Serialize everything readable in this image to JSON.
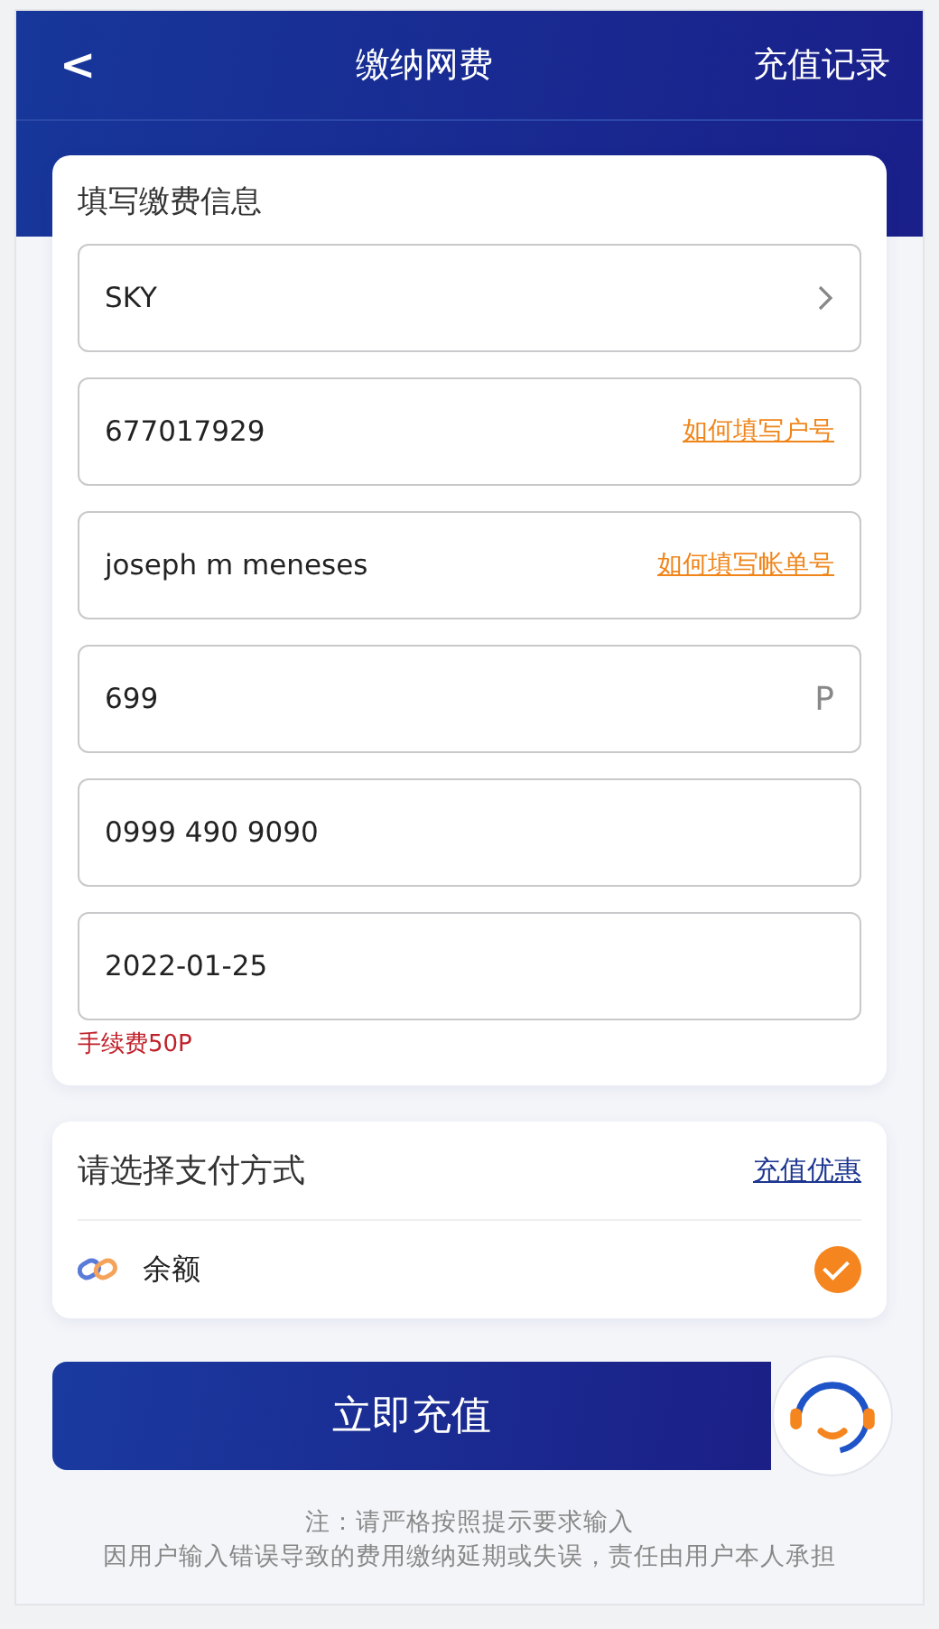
{
  "header": {
    "back": "<",
    "title": "缴纳网费",
    "action": "充值记录"
  },
  "form": {
    "title": "填写缴费信息",
    "fields": [
      {
        "kind": "select",
        "value": "SKY"
      },
      {
        "kind": "link",
        "value": "677017929",
        "link": "如何填写户号"
      },
      {
        "kind": "link",
        "value": "joseph m meneses",
        "link": "如何填写帐单号"
      },
      {
        "kind": "unit",
        "value": "699",
        "unit": "P"
      },
      {
        "kind": "plain",
        "value": "0999 490 9090"
      },
      {
        "kind": "plain",
        "value": "2022-01-25"
      }
    ],
    "fee": "手续费50P"
  },
  "payment": {
    "title": "请选择支付方式",
    "link": "充值优惠",
    "methods": [
      {
        "label": "余额",
        "selected": true
      }
    ]
  },
  "submit": "立即充值",
  "notes": [
    "注：请严格按照提示要求输入",
    "因用户输入错误导致的费用缴纳延期或失误，责任由用户本人承担"
  ]
}
